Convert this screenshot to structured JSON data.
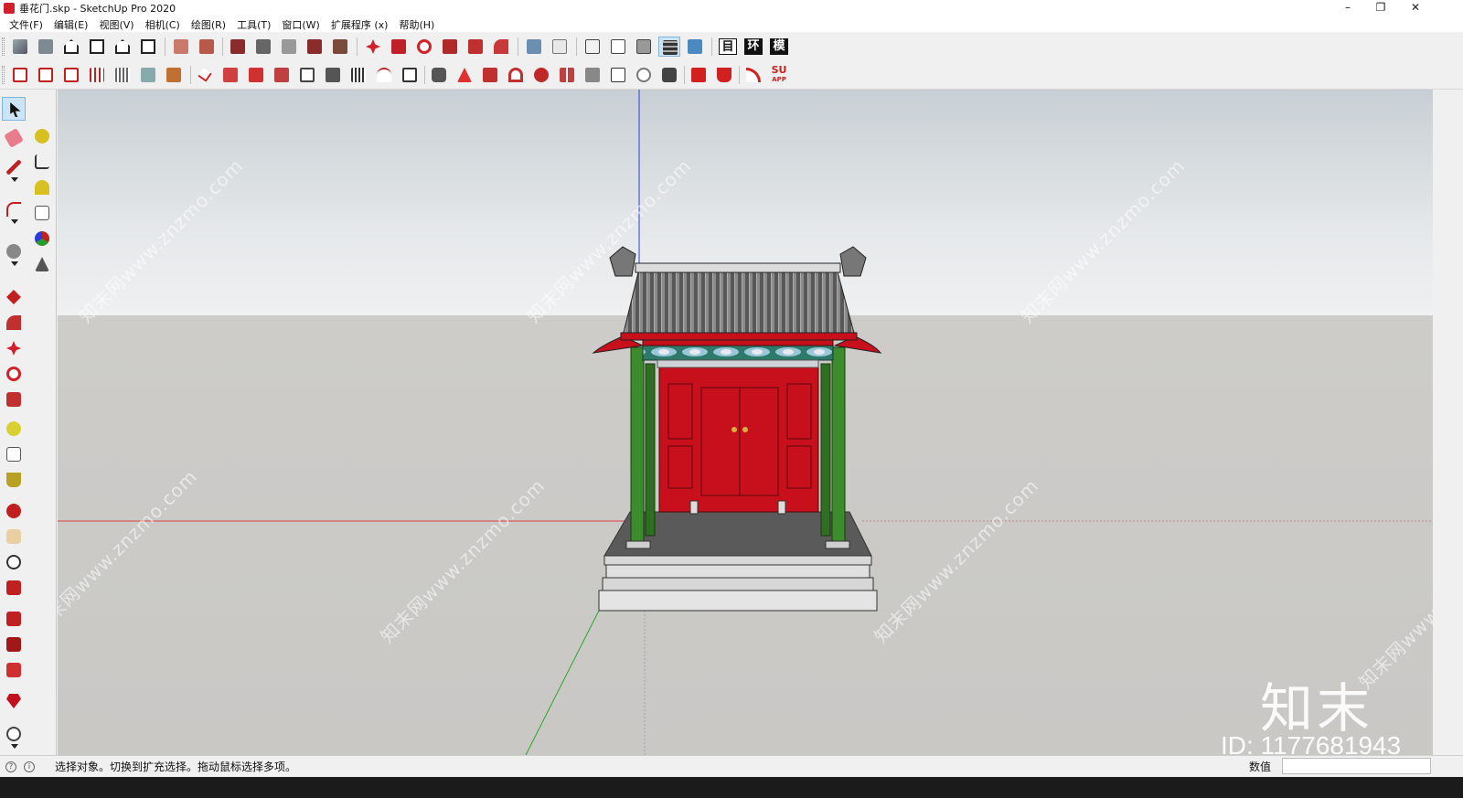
{
  "window": {
    "title": "垂花门.skp - SketchUp Pro 2020",
    "controls": [
      "–",
      "❐",
      "✕"
    ]
  },
  "menu": [
    "文件(F)",
    "编辑(E)",
    "视图(V)",
    "相机(C)",
    "绘图(R)",
    "工具(T)",
    "窗口(W)",
    "扩展程序 (x)",
    "帮助(H)"
  ],
  "toolbar_text_buttons": [
    "目",
    "环",
    "模"
  ],
  "toolbar_su_label": "SU",
  "toolbar_app_label": "APP",
  "status": {
    "message": "选择对象。切换到扩充选择。拖动鼠标选择多项。",
    "measurements_label": "数值",
    "measurements_value": ""
  },
  "watermark": {
    "site_text": "知末网www.znzmo.com",
    "brand": "知末",
    "id": "ID: 1177681943"
  },
  "colors": {
    "roof": "#6e6e6e",
    "door": "#c8101c",
    "column": "#3c8b2c",
    "blue_axis": "#2a3cd8",
    "red_axis": "#d84040",
    "green_axis": "#2aa82a"
  }
}
